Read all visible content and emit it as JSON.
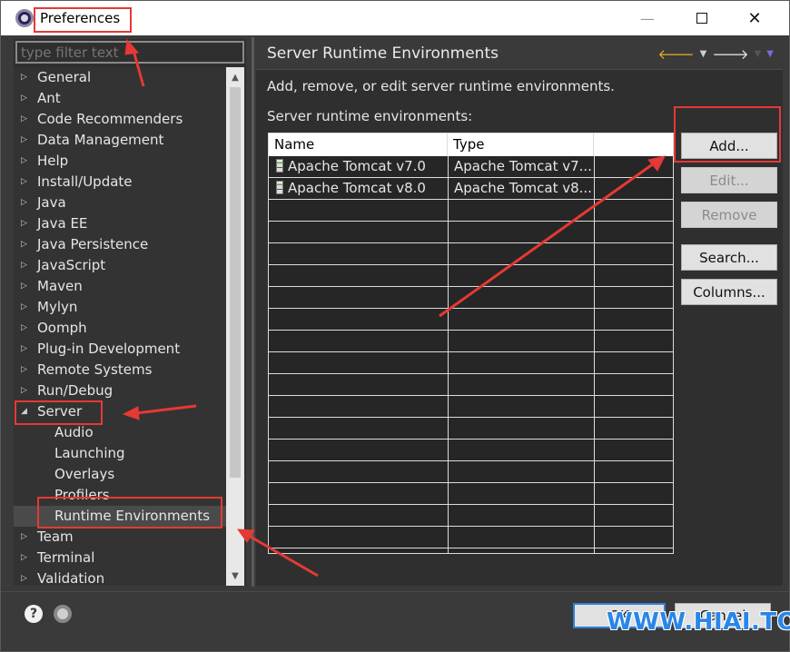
{
  "window": {
    "title": "Preferences",
    "controls": {
      "minimize": "—",
      "close": "✕"
    }
  },
  "filter": {
    "placeholder": "type filter text"
  },
  "tree": {
    "items": [
      {
        "label": "General",
        "expanded": false,
        "level": 0
      },
      {
        "label": "Ant",
        "expanded": false,
        "level": 0
      },
      {
        "label": "Code Recommenders",
        "expanded": false,
        "level": 0
      },
      {
        "label": "Data Management",
        "expanded": false,
        "level": 0
      },
      {
        "label": "Help",
        "expanded": false,
        "level": 0
      },
      {
        "label": "Install/Update",
        "expanded": false,
        "level": 0
      },
      {
        "label": "Java",
        "expanded": false,
        "level": 0
      },
      {
        "label": "Java EE",
        "expanded": false,
        "level": 0
      },
      {
        "label": "Java Persistence",
        "expanded": false,
        "level": 0
      },
      {
        "label": "JavaScript",
        "expanded": false,
        "level": 0
      },
      {
        "label": "Maven",
        "expanded": false,
        "level": 0
      },
      {
        "label": "Mylyn",
        "expanded": false,
        "level": 0
      },
      {
        "label": "Oomph",
        "expanded": false,
        "level": 0
      },
      {
        "label": "Plug-in Development",
        "expanded": false,
        "level": 0
      },
      {
        "label": "Remote Systems",
        "expanded": false,
        "level": 0
      },
      {
        "label": "Run/Debug",
        "expanded": false,
        "level": 0
      },
      {
        "label": "Server",
        "expanded": true,
        "level": 0
      },
      {
        "label": "Audio",
        "level": 1
      },
      {
        "label": "Launching",
        "level": 1
      },
      {
        "label": "Overlays",
        "level": 1
      },
      {
        "label": "Profilers",
        "level": 1
      },
      {
        "label": "Runtime Environments",
        "level": 1,
        "selected": true
      },
      {
        "label": "Team",
        "expanded": false,
        "level": 0
      },
      {
        "label": "Terminal",
        "expanded": false,
        "level": 0
      },
      {
        "label": "Validation",
        "expanded": false,
        "level": 0
      }
    ]
  },
  "page": {
    "title": "Server Runtime Environments",
    "description": "Add, remove, or edit server runtime environments.",
    "list_label": "Server runtime environments:"
  },
  "table": {
    "columns": [
      "Name",
      "Type"
    ],
    "rows": [
      {
        "name": "Apache Tomcat v7.0",
        "type": "Apache Tomcat v7..."
      },
      {
        "name": "Apache Tomcat v8.0",
        "type": "Apache Tomcat v8..."
      }
    ]
  },
  "buttons": {
    "add": "Add...",
    "edit": "Edit...",
    "remove": "Remove",
    "search": "Search...",
    "columns": "Columns..."
  },
  "footer": {
    "help": "?",
    "ok": "OK",
    "cancel": "Cancel"
  },
  "watermark": "WWW.HIAI.TOP",
  "colors": {
    "annotation": "#e53935",
    "accent_blue": "#2e7fd6",
    "back_arrow": "#e2b21e"
  }
}
